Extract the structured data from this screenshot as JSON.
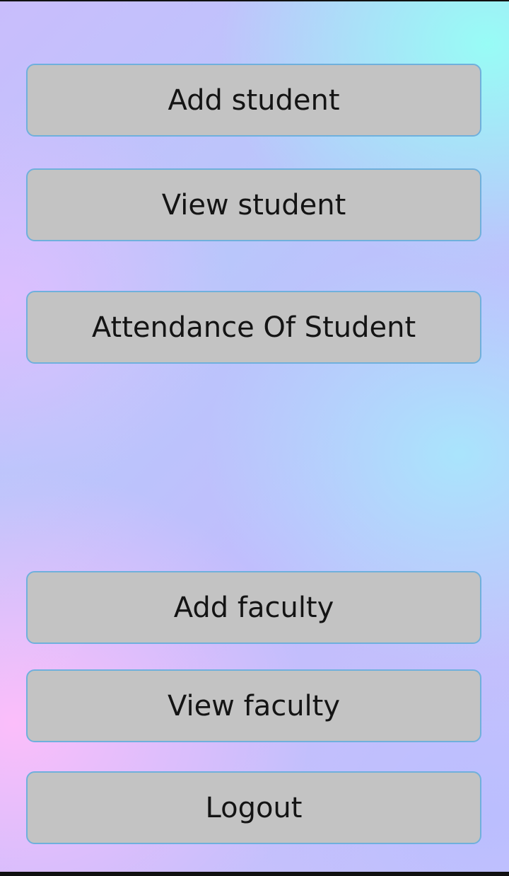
{
  "menu": {
    "buttons": [
      {
        "label": "Add student"
      },
      {
        "label": "View student"
      },
      {
        "label": "Attendance Of Student"
      },
      {
        "label": "Add faculty"
      },
      {
        "label": "View faculty"
      },
      {
        "label": "Logout"
      }
    ]
  },
  "colors": {
    "button_fill": "#c3c3c3",
    "button_border": "#6fb0dc",
    "text": "#141414"
  }
}
